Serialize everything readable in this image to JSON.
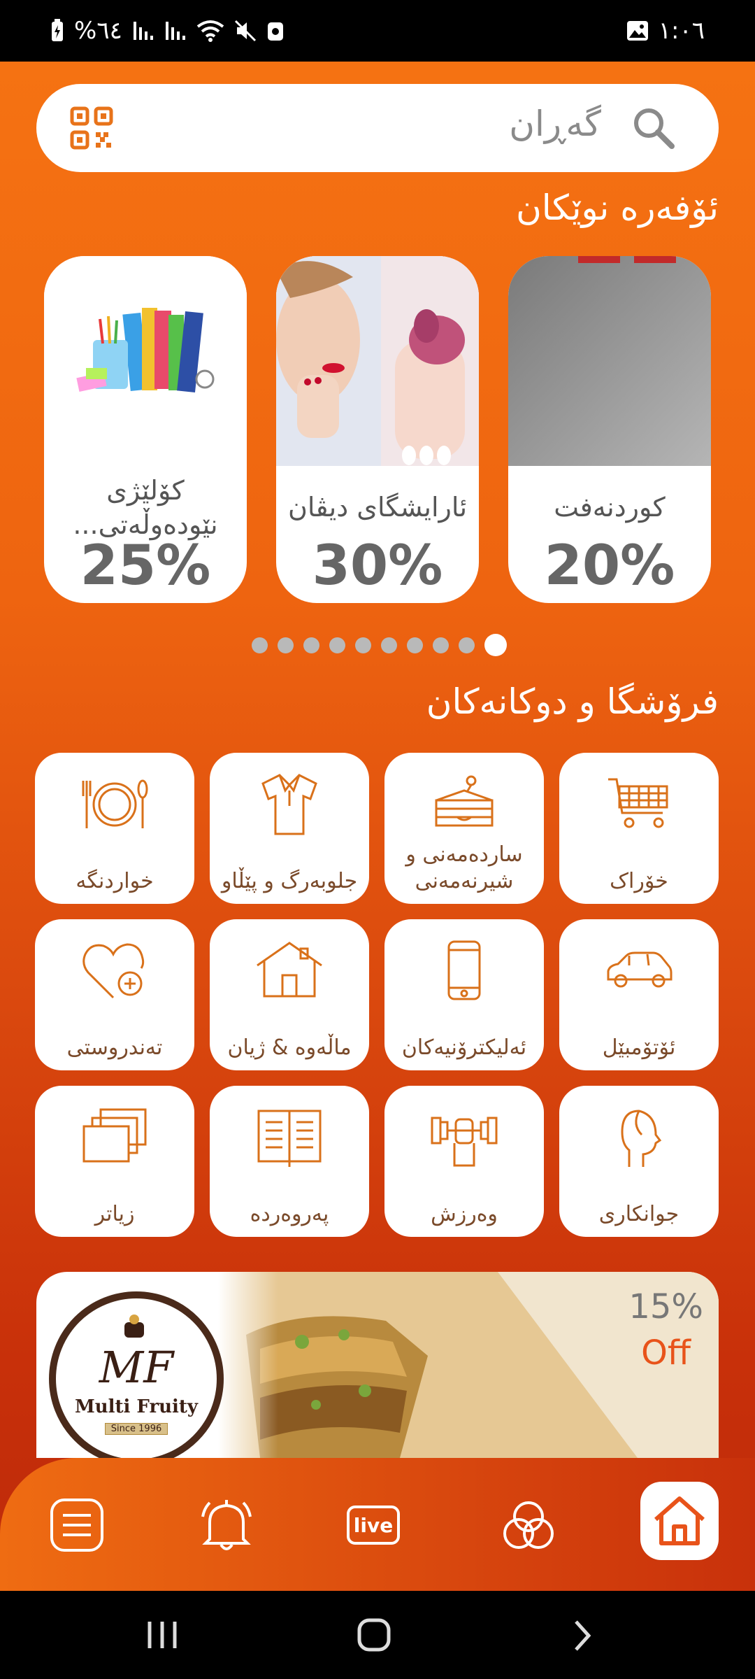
{
  "status_bar": {
    "battery": "%٦٤",
    "time": "١:٠٦"
  },
  "search": {
    "placeholder": "گەڕان"
  },
  "offers_section": {
    "title": "ئۆفەرە نوێکان",
    "items": [
      {
        "name": "کوردنەفت",
        "discount": "20%"
      },
      {
        "name": "ئارایشگای دیڤان",
        "discount": "30%"
      },
      {
        "name": "کۆلێژی نێودەوڵەتی...",
        "discount": "25%"
      }
    ],
    "page_count": 10,
    "active_page": 10
  },
  "categories_section": {
    "title": "فرۆشگا و دوکانەکان",
    "items": [
      {
        "label": "خۆراک",
        "icon": "shopping-cart-icon"
      },
      {
        "label": "ساردەمەنی و شیرنەمەنی",
        "icon": "cake-icon"
      },
      {
        "label": "جلوبەرگ و پێڵاو",
        "icon": "shirt-icon"
      },
      {
        "label": "خواردنگە",
        "icon": "plate-cutlery-icon"
      },
      {
        "label": "ئۆتۆمبێل",
        "icon": "car-icon"
      },
      {
        "label": "ئەلیکترۆنیەکان",
        "icon": "phone-icon"
      },
      {
        "label": "ماڵەوە & ژیان",
        "icon": "house-icon"
      },
      {
        "label": "تەندروستی",
        "icon": "heart-plus-icon"
      },
      {
        "label": "جوانکاری",
        "icon": "head-profile-icon"
      },
      {
        "label": "وەرزش",
        "icon": "dumbbell-icon"
      },
      {
        "label": "پەروەردە",
        "icon": "book-icon"
      },
      {
        "label": "زیاتر",
        "icon": "stack-icon"
      }
    ]
  },
  "banner": {
    "discount": "15%",
    "off_label": "Off",
    "logo_text": "Multi Fruity",
    "logo_since": "Since 1996"
  },
  "bottom_nav": {
    "live_label": "live"
  },
  "colors": {
    "accent": "#f07014",
    "accent_dark": "#c8300a",
    "icon": "#d9711a"
  }
}
